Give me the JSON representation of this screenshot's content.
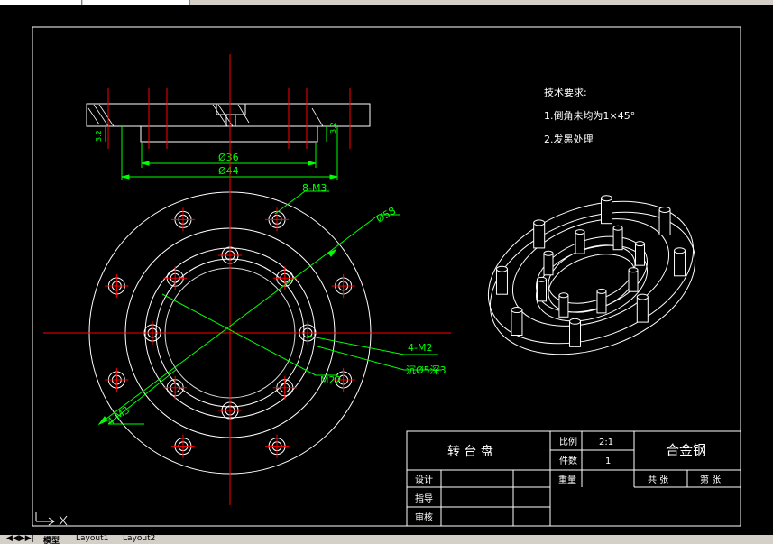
{
  "tech_requirements": {
    "title": "技术要求:",
    "items": [
      "1.倒角未均为1×45°",
      "2.发黑处理"
    ]
  },
  "dimensions": {
    "d36": "Ø36",
    "d44": "Ø44",
    "d58": "Ø58",
    "holes_8m3": "8-M3",
    "holes_4m2": "4-M2",
    "counterbore": "沉Ø5深3",
    "m22": "M22",
    "m3": "4-M3",
    "side_left": "3.2",
    "side_right": "3.2"
  },
  "title_block": {
    "part_name": "转 台 盘",
    "scale_label": "比例",
    "scale_value": "2:1",
    "count_label": "件数",
    "count_value": "1",
    "material": "合金钢",
    "design_label": "设计",
    "guide_label": "指导",
    "review_label": "审核",
    "weight_label": "重量",
    "total_sheets": "共 张",
    "sheet_no": "第 张"
  },
  "tabs": [
    "模型",
    "Layout1",
    "Layout2"
  ],
  "colors": {
    "background": "#000000",
    "line": "#ffffff",
    "center_line": "#ff0000",
    "dimension": "#00ff00"
  }
}
